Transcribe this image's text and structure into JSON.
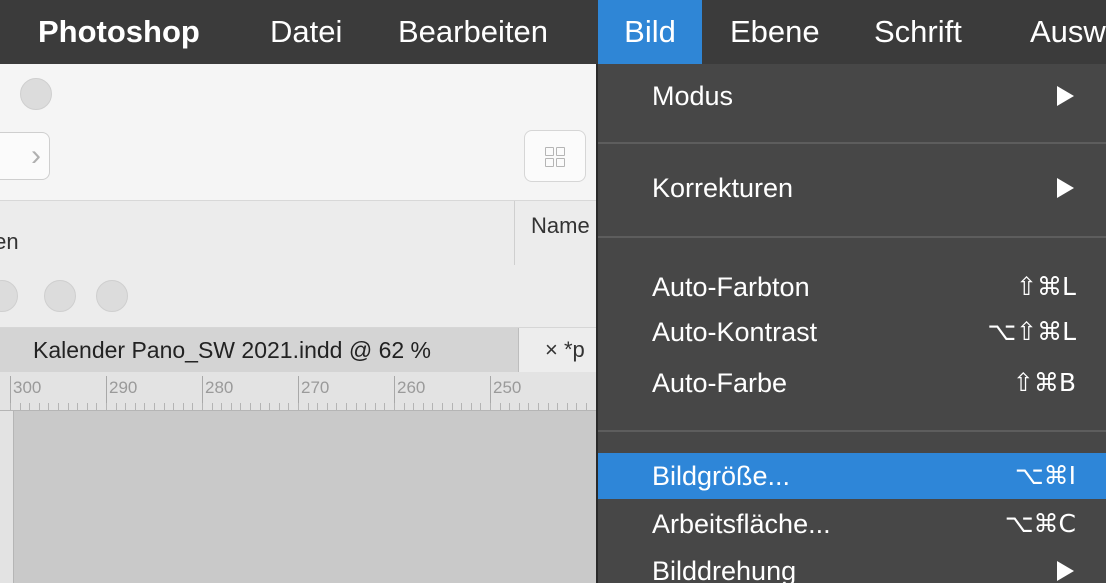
{
  "menubar": {
    "items": [
      {
        "label": "Photoshop"
      },
      {
        "label": "Datei"
      },
      {
        "label": "Bearbeiten"
      },
      {
        "label": "Bild"
      },
      {
        "label": "Ebene"
      },
      {
        "label": "Schrift"
      },
      {
        "label": "Ausw"
      }
    ]
  },
  "background_window": {
    "column_header_left": "ten",
    "column_header_name": "Name",
    "doc_tab": "Kalender Pano_SW 2021.indd @ 62 %",
    "second_tab": "×  *p",
    "ruler_labels": [
      "300",
      "290",
      "280",
      "270",
      "260",
      "250"
    ]
  },
  "menu": {
    "items": [
      {
        "label": "Modus",
        "shortcut": ""
      },
      {
        "label": "Korrekturen",
        "shortcut": ""
      },
      {
        "label": "Auto-Farbton",
        "shortcut": "⇧⌘L"
      },
      {
        "label": "Auto-Kontrast",
        "shortcut": "⌥⇧⌘L"
      },
      {
        "label": "Auto-Farbe",
        "shortcut": "⇧⌘B"
      },
      {
        "label": "Bildgröße...",
        "shortcut": "⌥⌘I"
      },
      {
        "label": "Arbeitsfläche...",
        "shortcut": "⌥⌘C"
      },
      {
        "label": "Bilddrehung",
        "shortcut": ""
      }
    ]
  },
  "colors": {
    "menubar_bg": "#3b3b3b",
    "accent_blue": "#2f86d6",
    "menu_bg": "#474747"
  }
}
